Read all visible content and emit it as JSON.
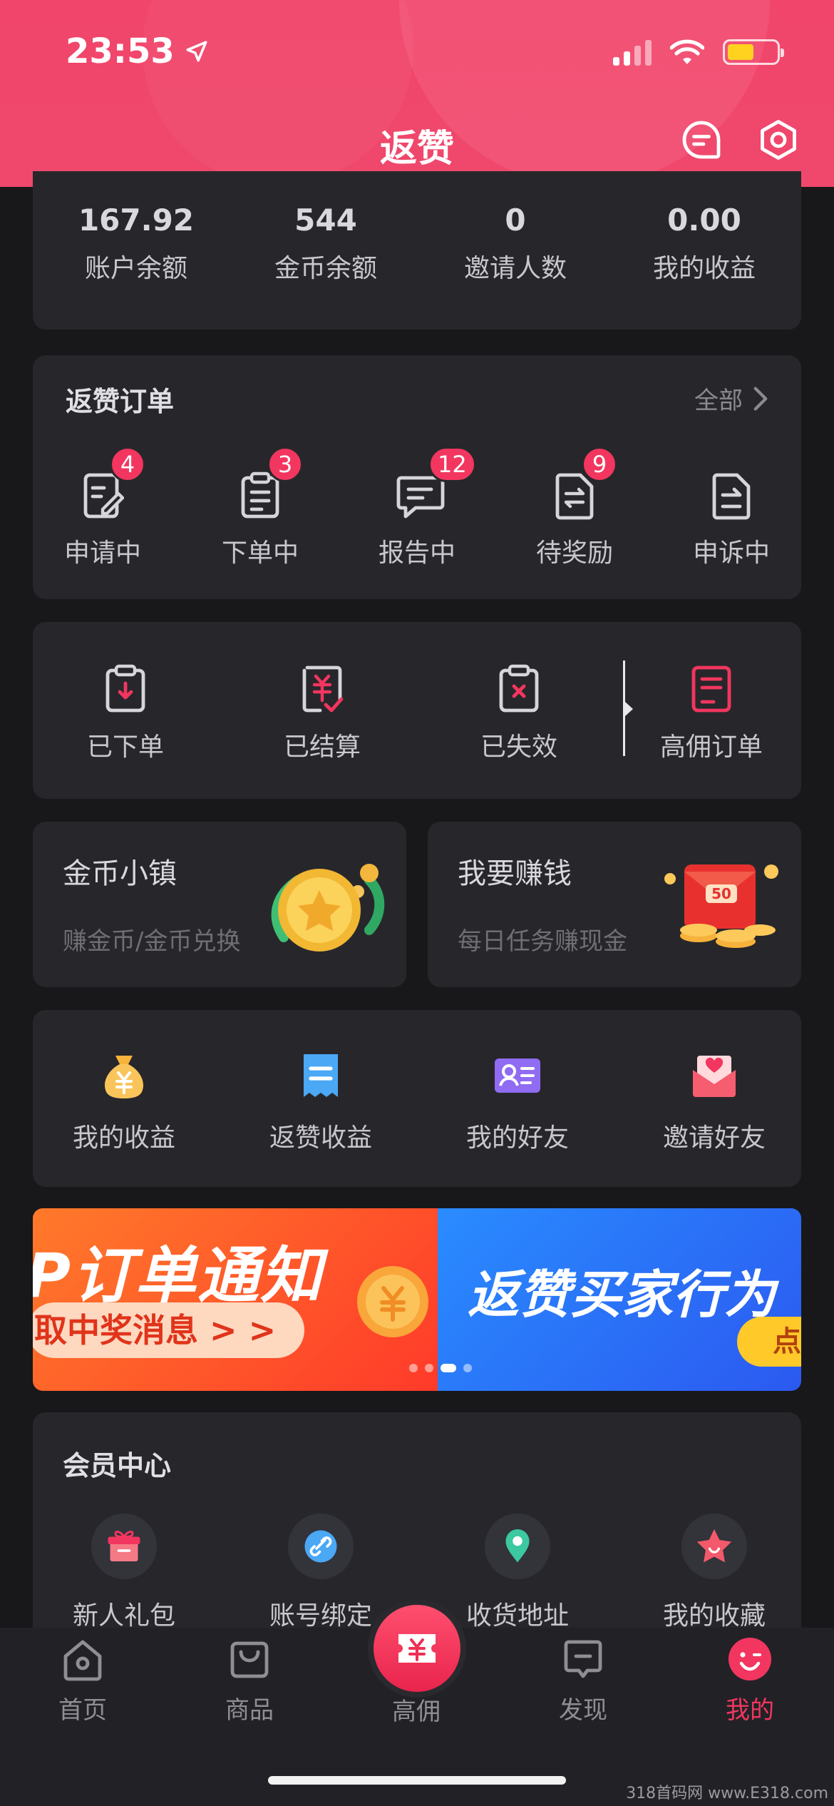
{
  "status_bar": {
    "time": "23:53"
  },
  "header": {
    "title": "返赞",
    "colors": {
      "primary": "#f1456b"
    }
  },
  "stats": [
    {
      "value": "167.92",
      "label": "账户余额"
    },
    {
      "value": "544",
      "label": "金币余额"
    },
    {
      "value": "0",
      "label": "邀请人数"
    },
    {
      "value": "0.00",
      "label": "我的收益"
    }
  ],
  "orders": {
    "title": "返赞订单",
    "more": "全部",
    "items": [
      {
        "label": "申请中",
        "badge": "4",
        "icon": "pencil-doc-icon"
      },
      {
        "label": "下单中",
        "badge": "3",
        "icon": "clipboard-icon"
      },
      {
        "label": "报告中",
        "badge": "12",
        "icon": "message-icon"
      },
      {
        "label": "待奖励",
        "badge": "9",
        "icon": "exchange-doc-icon"
      },
      {
        "label": "申诉中",
        "badge": "",
        "icon": "upload-doc-icon"
      }
    ]
  },
  "status_row": [
    {
      "label": "已下单",
      "icon": "ordered-icon"
    },
    {
      "label": "已结算",
      "icon": "settled-icon"
    },
    {
      "label": "已失效",
      "icon": "expired-icon"
    },
    {
      "label": "高佣订单",
      "icon": "high-commission-order-icon"
    }
  ],
  "features": [
    {
      "title": "金币小镇",
      "sub": "赚金币/金币兑换"
    },
    {
      "title": "我要赚钱",
      "sub": "每日任务赚现金",
      "tag": "50"
    }
  ],
  "grid": [
    {
      "label": "我的收益",
      "icon": "money-bag-icon"
    },
    {
      "label": "返赞收益",
      "icon": "receipt-icon"
    },
    {
      "label": "我的好友",
      "icon": "contact-card-icon"
    },
    {
      "label": "邀请好友",
      "icon": "invite-envelope-icon"
    }
  ],
  "banner": {
    "left_title": "P订单通知",
    "left_sub": "取中奖消息 > >",
    "right_title": "返赞买家行为",
    "right_btn": "点击"
  },
  "member": {
    "title": "会员中心",
    "items": [
      {
        "label": "新人礼包",
        "icon": "gift-icon"
      },
      {
        "label": "账号绑定",
        "icon": "link-icon"
      },
      {
        "label": "收货地址",
        "icon": "location-pin-icon"
      },
      {
        "label": "我的收藏",
        "icon": "star-icon"
      }
    ]
  },
  "tabs": [
    {
      "label": "首页",
      "icon": "home-icon"
    },
    {
      "label": "商品",
      "icon": "bag-icon"
    },
    {
      "label": "高佣",
      "icon": "coupon-icon"
    },
    {
      "label": "发现",
      "icon": "chat-icon"
    },
    {
      "label": "我的",
      "icon": "smile-icon",
      "active": true
    }
  ],
  "watermark": "318首码网 www.E318.com"
}
